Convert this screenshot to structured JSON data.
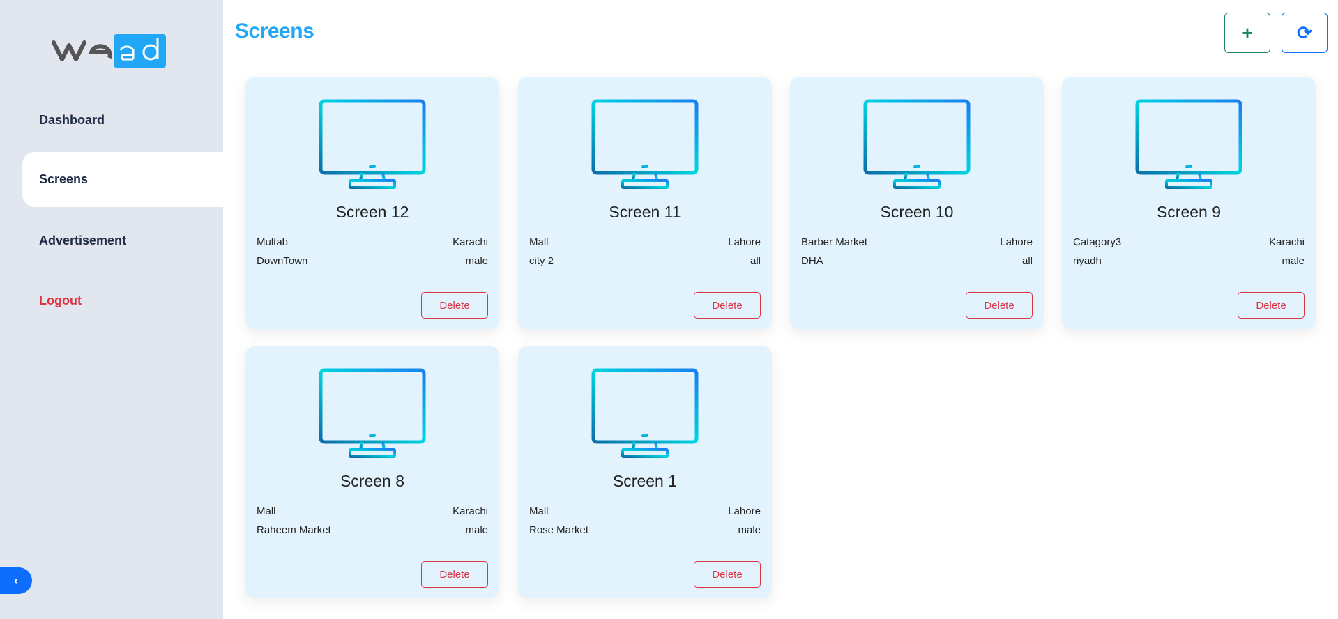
{
  "logo": {
    "text": "wead"
  },
  "sidebar": {
    "items": [
      {
        "label": "Dashboard"
      },
      {
        "label": "Screens"
      },
      {
        "label": "Advertisement"
      },
      {
        "label": "Logout"
      }
    ],
    "collapse_icon": "chevron-left-icon"
  },
  "header": {
    "title": "Screens",
    "add_icon": "plus-icon",
    "refresh_icon": "refresh-icon",
    "add_symbol": "+",
    "refresh_symbol": "⟳"
  },
  "cards": [
    {
      "name": "Screen 12",
      "category": "Multab",
      "city": "Karachi",
      "area": "DownTown",
      "gender": "male",
      "delete_label": "Delete"
    },
    {
      "name": "Screen 11",
      "category": "Mall",
      "city": "Lahore",
      "area": "city 2",
      "gender": "all",
      "delete_label": "Delete"
    },
    {
      "name": "Screen 10",
      "category": "Barber Market",
      "city": "Lahore",
      "area": "DHA",
      "gender": "all",
      "delete_label": "Delete"
    },
    {
      "name": "Screen 9",
      "category": "Catagory3",
      "city": "Karachi",
      "area": "riyadh",
      "gender": "male",
      "delete_label": "Delete"
    },
    {
      "name": "Screen 8",
      "category": "Mall",
      "city": "Karachi",
      "area": "Raheem Market",
      "gender": "male",
      "delete_label": "Delete"
    },
    {
      "name": "Screen 1",
      "category": "Mall",
      "city": "Lahore",
      "area": "Rose Market",
      "gender": "male",
      "delete_label": "Delete"
    }
  ],
  "colors": {
    "accent": "#21a7f5",
    "danger": "#dc3545",
    "success": "#198754",
    "primary": "#0d6efd"
  }
}
